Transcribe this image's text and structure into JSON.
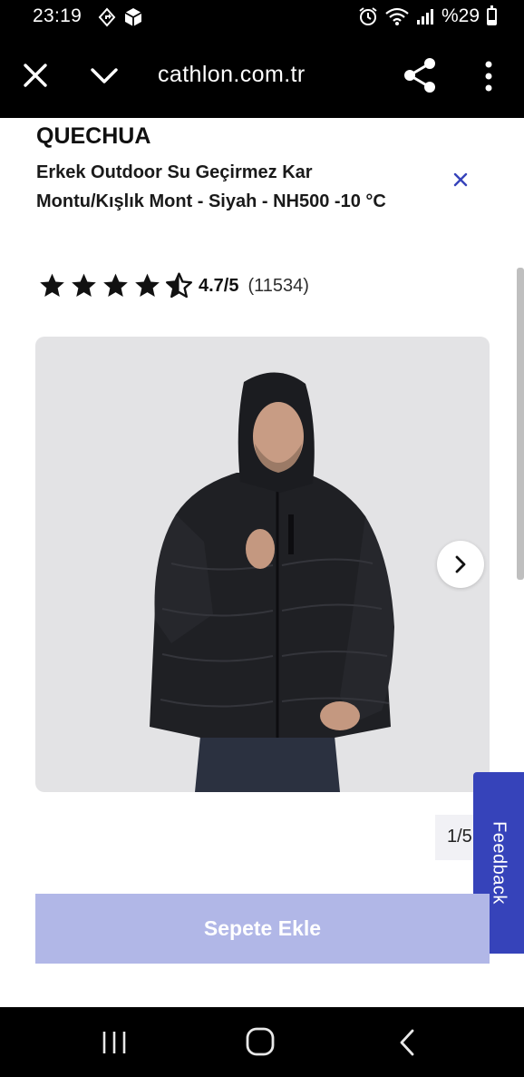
{
  "status_bar": {
    "time": "23:19",
    "battery": "%29",
    "icons": [
      "navigation-icon",
      "package-icon",
      "alarm-icon",
      "wifi-icon",
      "signal-icon",
      "battery-icon"
    ]
  },
  "browser": {
    "url": "cathlon.com.tr",
    "icons": [
      "close-icon",
      "chevron-down-icon",
      "share-icon",
      "more-vertical-icon"
    ]
  },
  "product": {
    "brand": "QUECHUA",
    "title": "Erkek Outdoor Su Geçirmez Kar Montu/Kışlık Mont - Siyah - NH500 -10 °C",
    "rating": {
      "stars": 4.7,
      "max_stars": 5,
      "score_text": "4.7/5",
      "count_text": "(11534)"
    },
    "image": {
      "alt_subject": "man wearing black hooded jacket",
      "background_color": "#e3e3e5"
    },
    "page_indicator": "1/5",
    "add_to_cart_label": "Sepete Ekle"
  },
  "feedback": {
    "label": "Feedback",
    "color": "#3643ba"
  },
  "colors": {
    "accent": "#3643ba",
    "cart_button_disabled": "#b1b7e7"
  },
  "nav": {
    "icons": [
      "recent-apps-icon",
      "home-icon",
      "back-icon"
    ]
  }
}
